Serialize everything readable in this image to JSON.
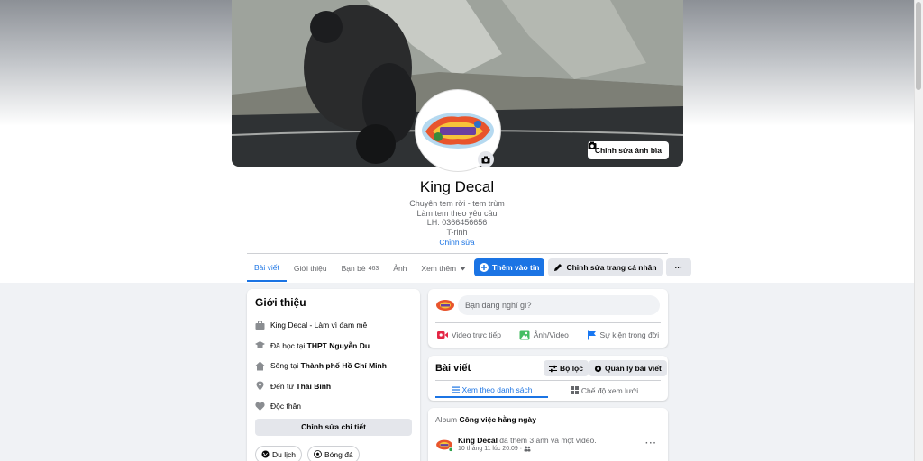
{
  "cover": {
    "edit_cover_label": "Chỉnh sửa ảnh bìa"
  },
  "profile": {
    "name": "King Decal",
    "bio": [
      "Chuyên tem rời - tem trùm",
      "Làm tem theo yêu cầu",
      "LH: 0366456656",
      "T-rinh"
    ],
    "edit_bio_label": "Chỉnh sửa"
  },
  "tabs": [
    {
      "label": "Bài viết",
      "active": true
    },
    {
      "label": "Giới thiệu"
    },
    {
      "label": "Bạn bè",
      "count": "463"
    },
    {
      "label": "Ảnh"
    },
    {
      "label": "Xem thêm"
    }
  ],
  "actions": {
    "add_story": "Thêm vào tin",
    "edit_profile": "Chỉnh sửa trang cá nhân",
    "more": "···"
  },
  "intro": {
    "title": "Giới thiệu",
    "items": [
      {
        "icon": "briefcase-icon",
        "prefix": "King Decal - Làm vì đam mê",
        "bold": ""
      },
      {
        "icon": "graduation-cap-icon",
        "prefix": "Đã học tại ",
        "bold": "THPT Nguyễn Du"
      },
      {
        "icon": "home-icon",
        "prefix": "Sống tại ",
        "bold": "Thành phố Hồ Chí Minh"
      },
      {
        "icon": "location-pin-icon",
        "prefix": "Đến từ ",
        "bold": "Thái Bình"
      },
      {
        "icon": "heart-icon",
        "prefix": "Độc thân",
        "bold": ""
      }
    ],
    "edit_details_label": "Chỉnh sửa chi tiết",
    "hobbies": [
      "Du lịch",
      "Bóng đá"
    ]
  },
  "composer": {
    "placeholder": "Bạn đang nghĩ gì?",
    "live_video": "Video trực tiếp",
    "photo_video": "Ảnh/Video",
    "life_event": "Sự kiện trong đời"
  },
  "posts": {
    "title": "Bài viết",
    "filter_label": "Bộ lọc",
    "manage_label": "Quản lý bài viết",
    "list_view": "Xem theo danh sách",
    "grid_view": "Chế độ xem lưới"
  },
  "post": {
    "album_prefix": "Album ",
    "album_name": "Công việc hằng ngày",
    "author": "King Decal",
    "action": " đã thêm 3 ảnh và một video.",
    "time": "10 tháng 11 lúc 20:09 ·",
    "more": "···"
  },
  "colors": {
    "accent": "#1b74e4",
    "background": "#f0f2f5",
    "card": "#ffffff",
    "secondary_button": "#e4e6eb"
  }
}
